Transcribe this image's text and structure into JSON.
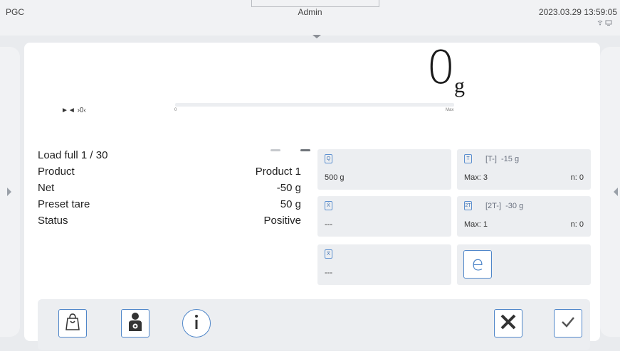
{
  "statusbar": {
    "device": "PGC",
    "user": "Admin",
    "datetime": "2023.03.29 13:59:05"
  },
  "display": {
    "weight": "0",
    "unit": "g",
    "bar_min": "0",
    "bar_max": "Max",
    "indicators": "►◄ ›0‹"
  },
  "info": [
    {
      "label": "Load full 1 / 30",
      "value": ""
    },
    {
      "label": "Product",
      "value": "Product 1"
    },
    {
      "label": "Net",
      "value": "-50 g"
    },
    {
      "label": "Preset tare",
      "value": "50 g"
    },
    {
      "label": "Status",
      "value": "Positive"
    }
  ],
  "tiles": {
    "quantity": {
      "icon": "Q",
      "value": "500 g"
    },
    "average": {
      "icon": "X̄",
      "value": "---"
    },
    "average_lim": {
      "icon": "X̄",
      "value": "---"
    },
    "t_minus": {
      "icon": "T",
      "label": "[T-]",
      "delta": "-15 g",
      "max": "Max: 3",
      "n": "n: 0"
    },
    "t2_minus": {
      "icon": "2T",
      "label": "[2T-]",
      "delta": "-30 g",
      "max": "Max: 1",
      "n": "n: 0"
    },
    "e_mark": {
      "symbol": "e"
    }
  },
  "toolbar": {
    "buttons": [
      "bag-icon",
      "operator-icon",
      "info-icon",
      "cancel-icon",
      "confirm-icon"
    ]
  },
  "colors": {
    "accent": "#4f86c9",
    "tile_bg": "#eceef1",
    "background": "#e9ebee"
  }
}
